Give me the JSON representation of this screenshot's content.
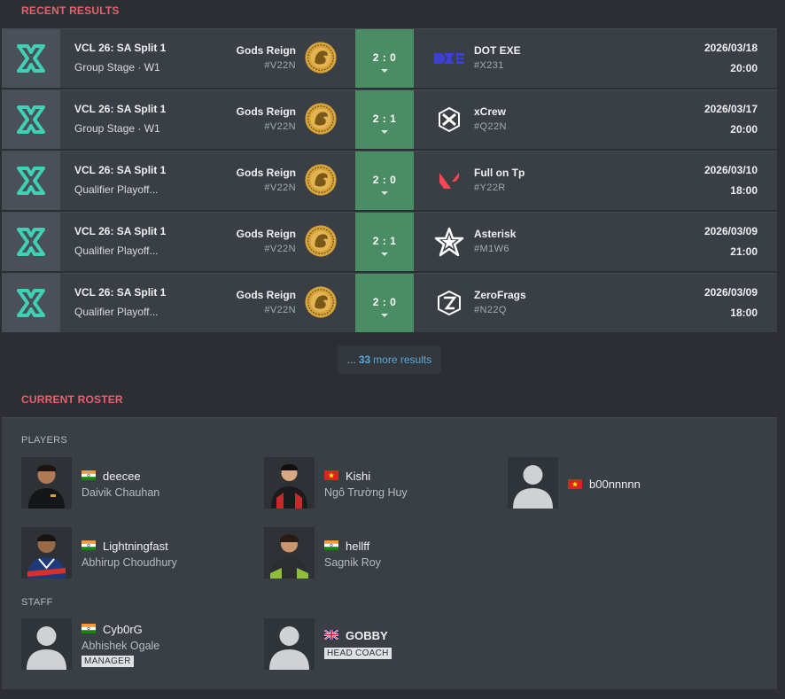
{
  "sections": {
    "recent_results": "RECENT RESULTS",
    "current_roster": "CURRENT ROSTER"
  },
  "matches": [
    {
      "event": "VCL 26: SA Split 1",
      "stage": "Group Stage · W1",
      "home_name": "Gods Reign",
      "home_tag": "#V22N",
      "score": "2 : 0",
      "away_name": "DOT EXE",
      "away_tag": "#X231",
      "away_icon": "dot-exe-icon",
      "date": "2026/03/18",
      "time": "20:00"
    },
    {
      "event": "VCL 26: SA Split 1",
      "stage": "Group Stage · W1",
      "home_name": "Gods Reign",
      "home_tag": "#V22N",
      "score": "2 : 1",
      "away_name": "xCrew",
      "away_tag": "#Q22N",
      "away_icon": "xcrew-icon",
      "date": "2026/03/17",
      "time": "20:00"
    },
    {
      "event": "VCL 26: SA Split 1",
      "stage": "Qualifier Playoff...",
      "home_name": "Gods Reign",
      "home_tag": "#V22N",
      "score": "2 : 0",
      "away_name": "Full on Tp",
      "away_tag": "#Y22R",
      "away_icon": "valorant-icon",
      "date": "2026/03/10",
      "time": "18:00"
    },
    {
      "event": "VCL 26: SA Split 1",
      "stage": "Qualifier Playoff...",
      "home_name": "Gods Reign",
      "home_tag": "#V22N",
      "score": "2 : 1",
      "away_name": "Asterisk",
      "away_tag": "#M1W6",
      "away_icon": "star-icon",
      "date": "2026/03/09",
      "time": "21:00"
    },
    {
      "event": "VCL 26: SA Split 1",
      "stage": "Qualifier Playoff...",
      "home_name": "Gods Reign",
      "home_tag": "#V22N",
      "score": "2 : 0",
      "away_name": "ZeroFrags",
      "away_tag": "#N22Q",
      "away_icon": "zerofrags-icon",
      "date": "2026/03/09",
      "time": "18:00"
    }
  ],
  "more_results": {
    "prefix": "...",
    "count": "33",
    "label": "more results"
  },
  "roster": {
    "players_label": "PLAYERS",
    "staff_label": "STAFF",
    "players": [
      {
        "alias": "deecee",
        "real": "Daivik Chauhan",
        "flag": "india-flag-icon"
      },
      {
        "alias": "Kishi",
        "real": "Ngô Trường Huy",
        "flag": "vietnam-flag-icon"
      },
      {
        "alias": "b00nnnnn",
        "real": "",
        "flag": "vietnam-flag-icon"
      },
      {
        "alias": "Lightningfast",
        "real": "Abhirup Choudhury",
        "flag": "india-flag-icon"
      },
      {
        "alias": "hellff",
        "real": "Sagnik Roy",
        "flag": "india-flag-icon"
      }
    ],
    "staff": [
      {
        "alias": "Cyb0rG",
        "real": "Abhishek Ogale",
        "role": "MANAGER",
        "flag": "india-flag-icon"
      },
      {
        "alias": "GOBBY",
        "real": "",
        "role": "HEAD COACH",
        "flag": "uk-flag-icon"
      }
    ]
  },
  "colors": {
    "accent": "#e9606c",
    "win": "#4a8c64",
    "link": "#5ba8d8",
    "bg": "#2b2f34",
    "panel": "#3a3f45"
  }
}
